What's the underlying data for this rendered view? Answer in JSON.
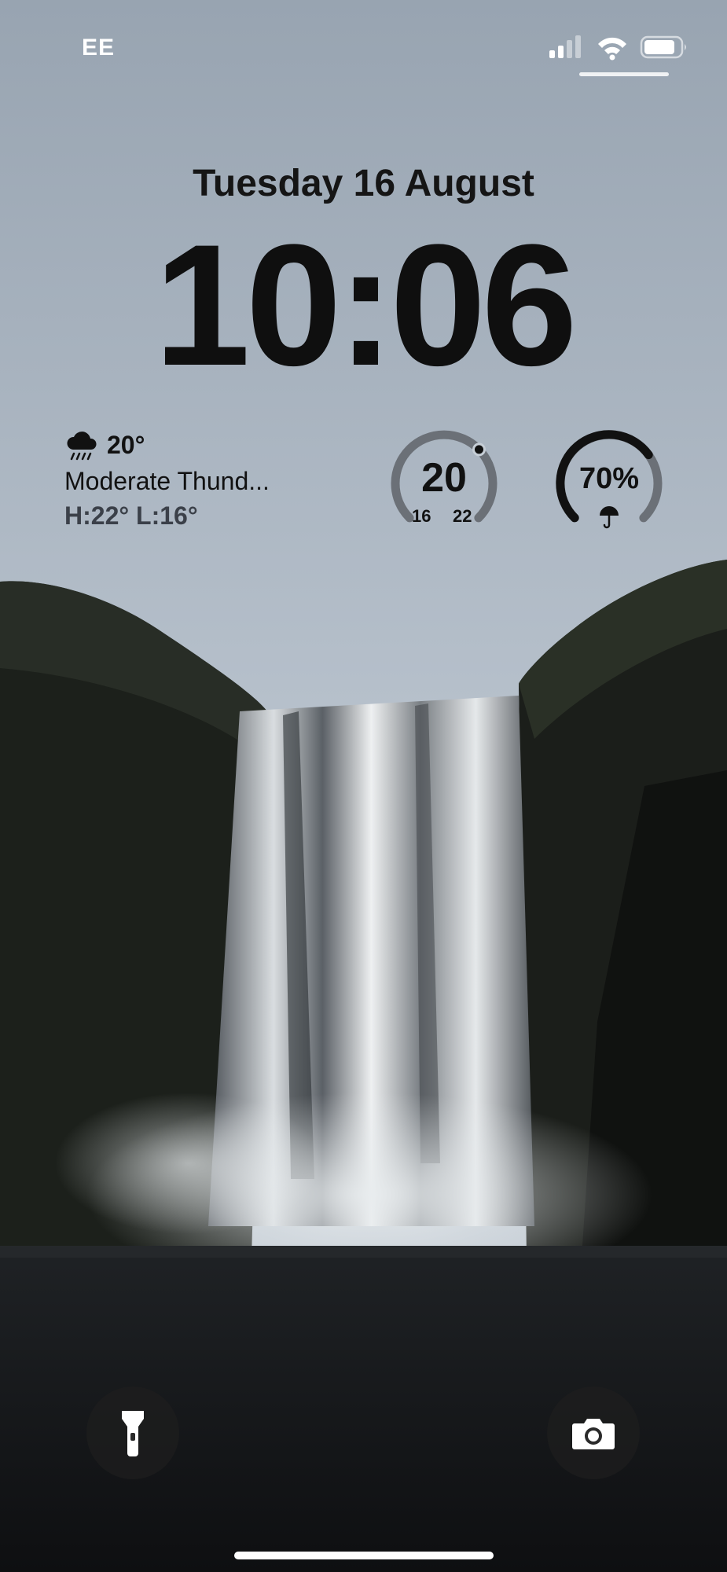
{
  "status_bar": {
    "carrier": "EE",
    "icons": [
      "signal-icon",
      "wifi-icon",
      "battery-icon"
    ]
  },
  "lock_screen": {
    "date": "Tuesday 16 August",
    "time": "10:06"
  },
  "widgets": {
    "weather": {
      "icon": "cloud-rain-icon",
      "temperature": "20°",
      "condition": "Moderate Thund...",
      "high_low": "H:22° L:16°"
    },
    "temp_gauge": {
      "value": "20",
      "low": "16",
      "high": "22",
      "level_fraction": 0.67
    },
    "rain_gauge": {
      "value": "70%",
      "icon": "umbrella-icon",
      "level_fraction": 0.7
    }
  },
  "quick_actions": {
    "flashlight": "flashlight-icon",
    "camera": "camera-icon"
  },
  "colors": {
    "sky_top": "#9aa6b2",
    "sky_bottom": "#c3cbd3",
    "cliff": "#1a1d1a",
    "water": "#dfe3e6",
    "ground": "#141618"
  }
}
